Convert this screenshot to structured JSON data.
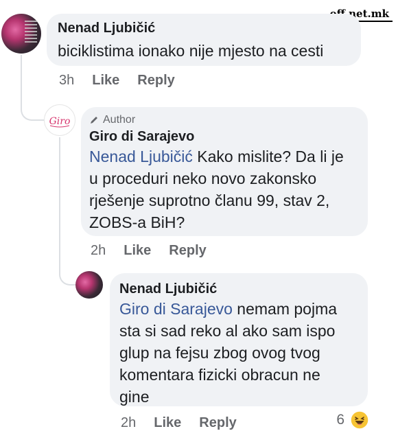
{
  "watermark": "off.net.mk",
  "comments": [
    {
      "author_name": "Nenad Ljubičić",
      "text": "biciklistima ionako nije mjesto na cesti",
      "time": "3h",
      "like_label": "Like",
      "reply_label": "Reply"
    },
    {
      "badge_label": "Author",
      "author_name": "Giro di Sarajevo",
      "mention": "Nenad Ljubičić",
      "text_lines": [
        " Kako mislite? Da li je",
        "u proceduri neko novo zakonsko",
        "rješenje suprotno članu 99, stav 2,",
        "ZOBS-a BiH?"
      ],
      "time": "2h",
      "like_label": "Like",
      "reply_label": "Reply"
    },
    {
      "author_name": "Nenad Ljubičić",
      "mention": "Giro di Sarajevo",
      "text_lines": [
        " nemam pojma",
        "sta si sad reko al ako sam ispo",
        "glup na fejsu zbog ovog tvog",
        "komentara fizicki obracun ne",
        "gine"
      ],
      "time": "2h",
      "like_label": "Like",
      "reply_label": "Reply",
      "reaction_count": "6"
    }
  ],
  "colors": {
    "bubble": "#f0f2f5",
    "mention": "#385898",
    "secondary_text": "#65676b",
    "haha_yellow": "#f7c434"
  },
  "icons": {
    "author_badge": "pencil-icon",
    "reaction": "haha-emoji-icon"
  }
}
